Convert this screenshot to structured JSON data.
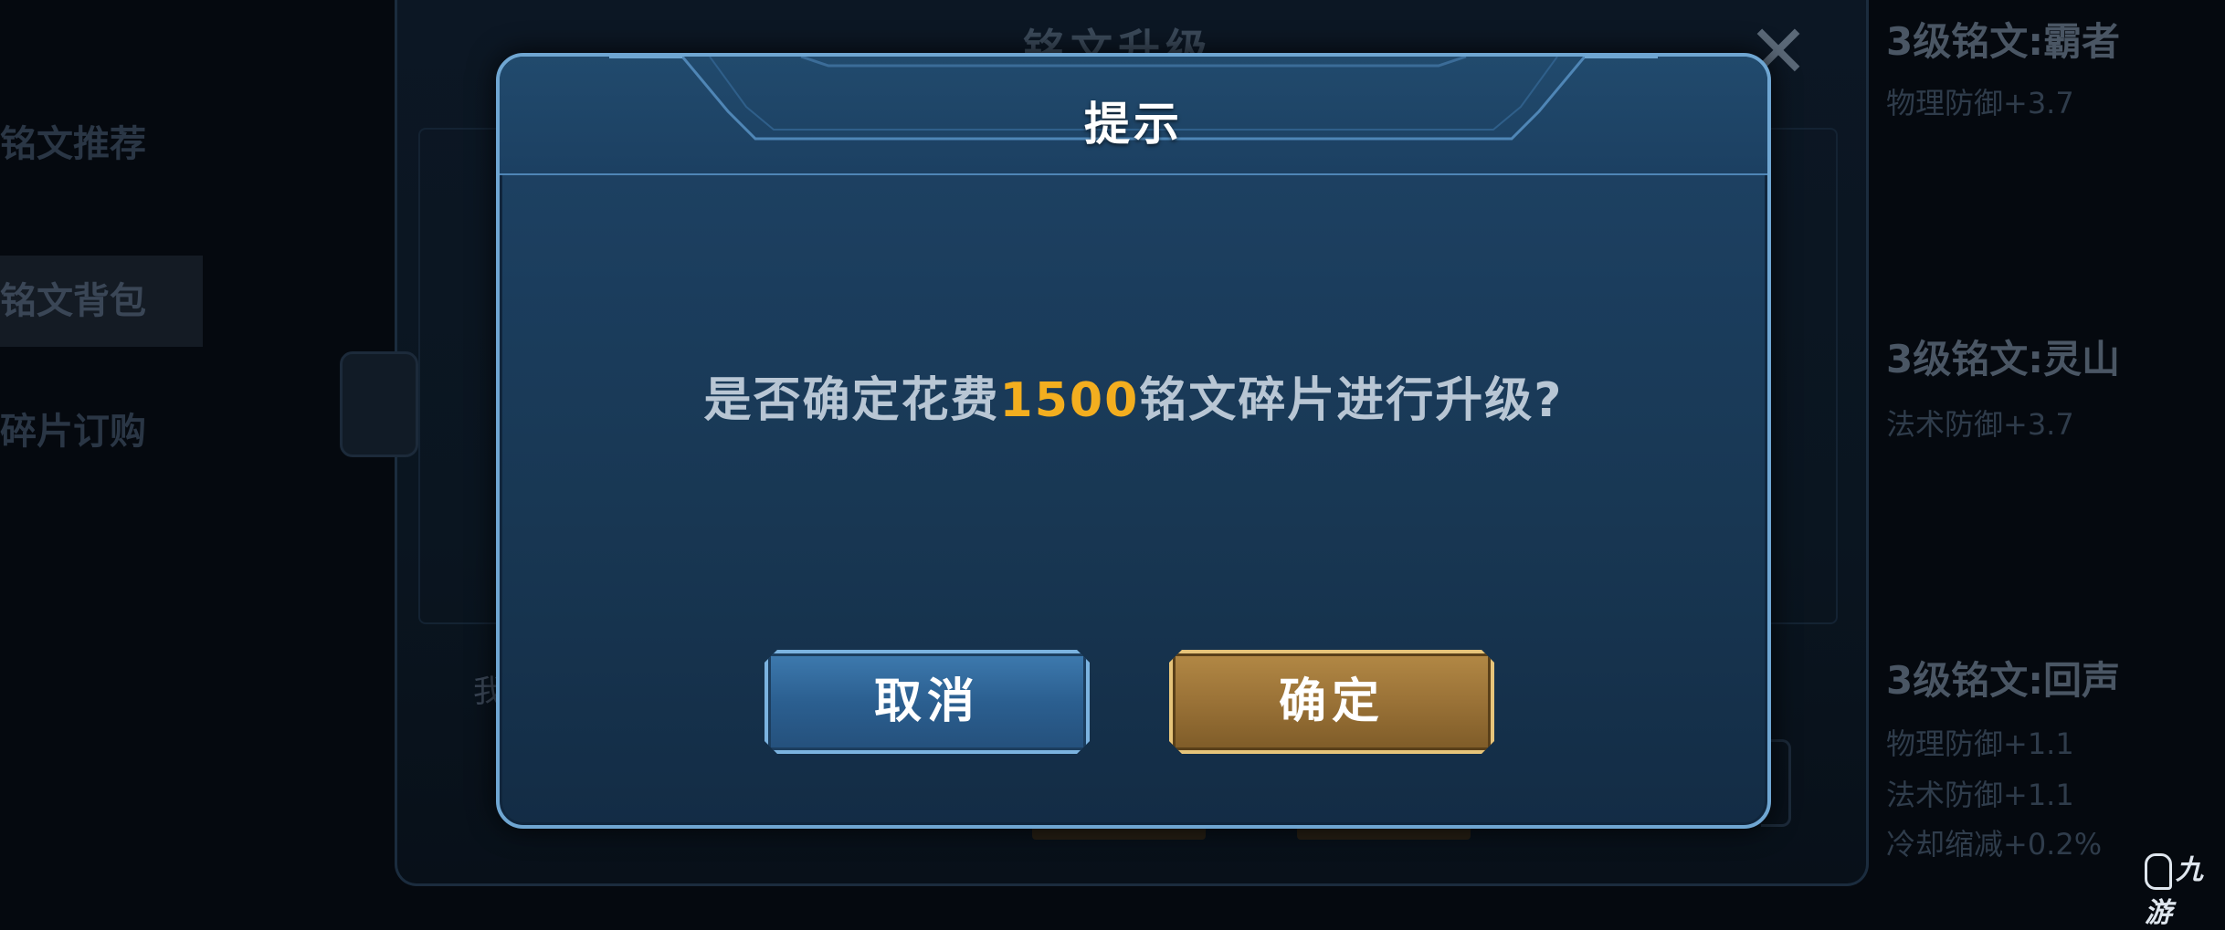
{
  "background": {
    "left_menu": [
      "铭文推荐",
      "铭文背包",
      "碎片订购"
    ],
    "panel_title": "铭文升级",
    "close_glyph": "✕",
    "partial_text": "我",
    "right_column": [
      {
        "title": "3级铭文:霸者",
        "stats": [
          "物理防御+3.7"
        ]
      },
      {
        "title": "3级铭文:灵山",
        "stats": [
          "法术防御+3.7"
        ]
      },
      {
        "title": "3级铭文:回声",
        "stats": [
          "物理防御+1.1",
          "法术防御+1.1",
          "冷却缩减+0.2%"
        ]
      }
    ],
    "watermark": "九游"
  },
  "dialog": {
    "title": "提示",
    "message_prefix": "是否确定花费",
    "message_amount": "1500",
    "message_suffix": "铭文碎片进行升级?",
    "cancel_label": "取消",
    "confirm_label": "确定"
  },
  "colors": {
    "dialog_bg": "#1b3d5d",
    "dialog_border": "#6fa6d2",
    "highlight": "#f3ae1f",
    "cancel_btn": "#2b5f90",
    "confirm_btn": "#9a7237"
  }
}
